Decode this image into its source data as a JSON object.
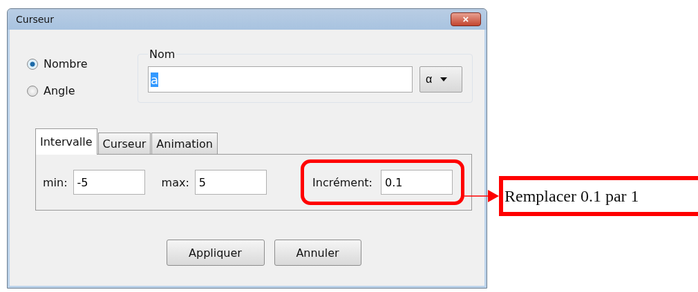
{
  "window": {
    "title": "Curseur",
    "close_label": "×"
  },
  "radios": [
    {
      "label": "Nombre",
      "selected": true
    },
    {
      "label": "Angle",
      "selected": false
    }
  ],
  "name_group": {
    "legend": "Nom",
    "value": "a",
    "value_selected": true,
    "symbol": "α"
  },
  "tabs": [
    {
      "label": "Intervalle",
      "selected": true
    },
    {
      "label": "Curseur",
      "selected": false
    },
    {
      "label": "Animation",
      "selected": false
    }
  ],
  "fields": [
    {
      "label": "min:",
      "value": "-5",
      "highlighted": false
    },
    {
      "label": "max:",
      "value": "5",
      "highlighted": false
    },
    {
      "label": "Incrément:",
      "value": "0.1",
      "highlighted": true
    }
  ],
  "buttons": [
    "Appliquer",
    "Annuler"
  ],
  "callout": {
    "text": "Remplacer 0.1 par 1"
  }
}
